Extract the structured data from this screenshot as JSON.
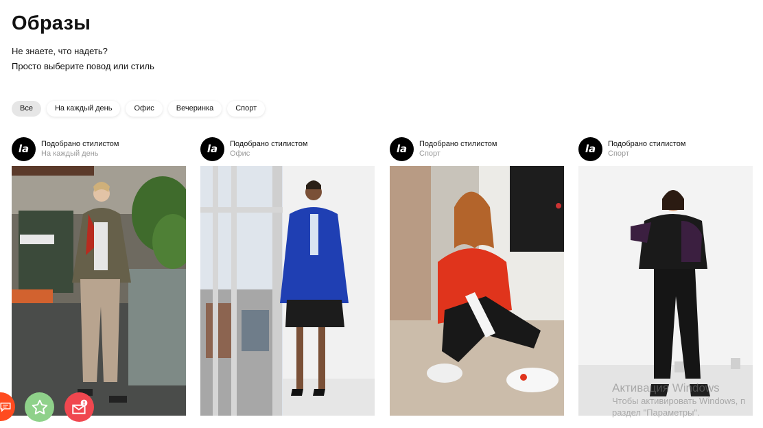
{
  "header": {
    "title": "Образы",
    "subtitle_line1": "Не знаете, что надеть?",
    "subtitle_line2": "Просто выберите повод или стиль"
  },
  "filters": [
    {
      "label": "Все",
      "active": true
    },
    {
      "label": "На каждый день",
      "active": false
    },
    {
      "label": "Офис",
      "active": false
    },
    {
      "label": "Вечеринка",
      "active": false
    },
    {
      "label": "Спорт",
      "active": false
    }
  ],
  "brand_logo_text": "la",
  "cards": [
    {
      "by": "Подобрано стилистом",
      "category": "На каждый день",
      "photo_icon": "woman-casual-look-photo"
    },
    {
      "by": "Подобрано стилистом",
      "category": "Офис",
      "photo_icon": "woman-office-look-photo"
    },
    {
      "by": "Подобрано стилистом",
      "category": "Спорт",
      "photo_icon": "woman-sport-look-photo"
    },
    {
      "by": "Подобрано стилистом",
      "category": "Спорт",
      "photo_icon": "woman-sport-look-photo"
    }
  ],
  "floating_buttons": [
    {
      "icon": "chat-icon",
      "color": "#ff4b1f"
    },
    {
      "icon": "star-icon",
      "color": "#8fd18a"
    },
    {
      "icon": "mail-alert-icon",
      "color": "#f0474f"
    }
  ],
  "watermark": {
    "line1": "Активация Windows",
    "line2": "Чтобы активировать Windows, п",
    "line3": "раздел \"Параметры\"."
  }
}
